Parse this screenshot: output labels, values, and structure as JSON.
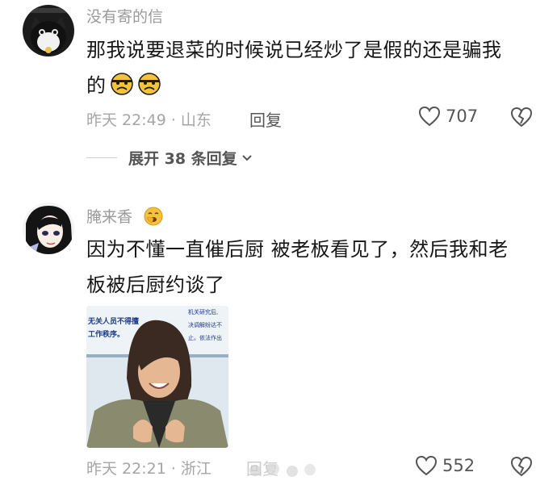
{
  "comments": [
    {
      "username": "没有寄的信",
      "text_line1": "那我说要退菜的时候说已经炒了是假的还是骗我",
      "text_line2": "的",
      "meta": "昨天 22:49 · 山东",
      "reply_label": "回复",
      "likes": "707",
      "expand_label": "展开 38 条回复"
    },
    {
      "username": "腌来香",
      "text_line1": "因为不懂一直催后厨 被老板看见了，然后我和老",
      "text_line2": "板被后厨约谈了",
      "meta": "昨天 22:21 · 浙江",
      "reply_label": "回复",
      "likes": "552",
      "photo_sign_lines": [
        "无关人员不得擅",
        "工作秩序。",
        "机关研究后,",
        "决调解纷达不",
        "止。依法作出"
      ]
    }
  ],
  "colors": {
    "meta_gray": "#a5a5a5",
    "text": "#161616"
  }
}
